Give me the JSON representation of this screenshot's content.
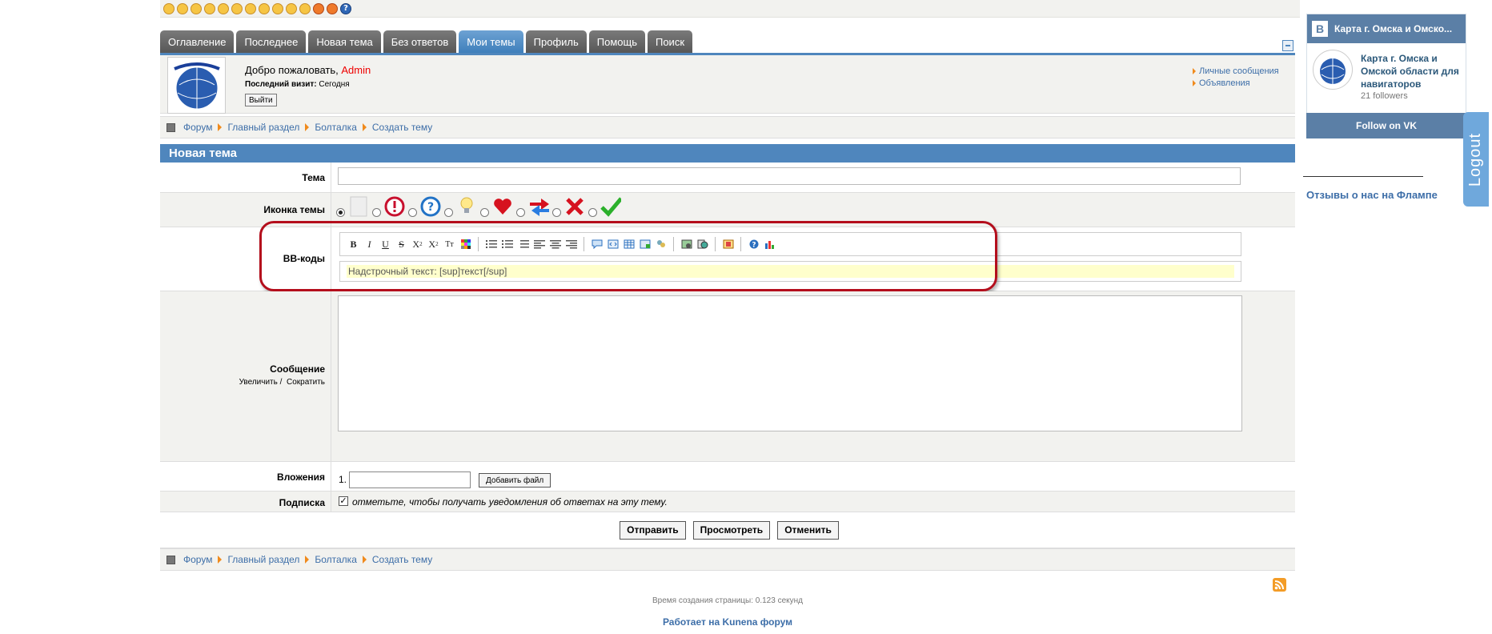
{
  "tabs": [
    {
      "label": "Оглавление"
    },
    {
      "label": "Последнее"
    },
    {
      "label": "Новая тема"
    },
    {
      "label": "Без ответов"
    },
    {
      "label": "Мои темы",
      "active": true
    },
    {
      "label": "Профиль"
    },
    {
      "label": "Помощь"
    },
    {
      "label": "Поиск"
    }
  ],
  "user": {
    "welcome_prefix": "Добро пожаловать,",
    "name": "Admin",
    "last_visit_label": "Последний визит:",
    "last_visit_value": "Сегодня",
    "logout_label": "Выйти",
    "links": [
      "Личные сообщения",
      "Объявления"
    ]
  },
  "breadcrumbs": [
    "Форум",
    "Главный раздел",
    "Болталка",
    "Создать тему"
  ],
  "form": {
    "title": "Новая тема",
    "topic_label": "Тема",
    "icon_label": "Иконка темы",
    "bbcode_label": "BB-коды",
    "bbcode_hint": "Надстрочный текст: [sup]текст[/sup]",
    "message_label": "Сообщение",
    "enlarge": "Увеличить /",
    "shrink": "Сократить",
    "attachments_label": "Вложения",
    "attachment_index": "1.",
    "add_file": "Добавить файл",
    "subscribe_label": "Подписка",
    "subscribe_text": "отметьте, чтобы получать уведомления об ответах на эту тему.",
    "submit": "Отправить",
    "preview": "Просмотреть",
    "cancel": "Отменить"
  },
  "footer": {
    "time": "Время создания страницы: 0.123 секунд",
    "powered": "Работает на Kunena форум"
  },
  "sidebar": {
    "vk_title": "Карта г. Омска и Омско...",
    "vk_name": "Карта г. Омска и Омской области для навигаторов",
    "vk_followers": "21 followers",
    "vk_follow": "Follow on VK",
    "flamp": "Отзывы о нас на Флампе",
    "logout_tab": "Logout"
  },
  "colors": {
    "accent": "#4f86bd",
    "highlight": "#b40e1c"
  }
}
